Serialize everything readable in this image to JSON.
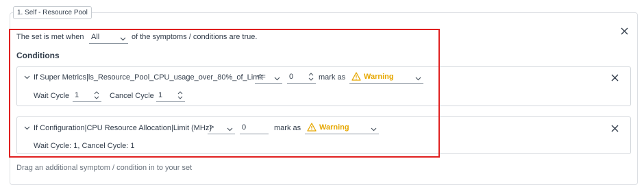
{
  "set": {
    "tag_label": "1. Self - Resource Pool",
    "sentence_prefix": "The set is met when",
    "match_value": "All",
    "sentence_suffix": "of the symptoms / conditions are true.",
    "conditions_heading": "Conditions",
    "drag_hint": "Drag an additional symptom / condition in to your set"
  },
  "conditions": [
    {
      "text": "If Super Metrics|ls_Resource_Pool_CPU_usage_over_80%_of_Limit",
      "operator": "<=",
      "value": "0",
      "mark_as_label": "mark as",
      "severity": "Warning",
      "wait_cycle_label": "Wait Cycle",
      "wait_cycle_value": "1",
      "cancel_cycle_label": "Cancel Cycle",
      "cancel_cycle_value": "1"
    },
    {
      "text": "If Configuration|CPU Resource Allocation|Limit (MHz)",
      "operator": ">",
      "value": "0",
      "mark_as_label": "mark as",
      "severity": "Warning",
      "summary": "Wait Cycle: 1, Cancel Cycle: 1"
    }
  ],
  "icons": {
    "close": "close-icon",
    "chevron_down": "chevron-down-icon",
    "chevron_right": "chevron-icon",
    "warning": "warning-icon",
    "spinner": "spinner-icon"
  },
  "colors": {
    "warning": "#e6a700",
    "highlight": "#e02020",
    "text": "#313c4a",
    "border": "#d3d7dc"
  }
}
